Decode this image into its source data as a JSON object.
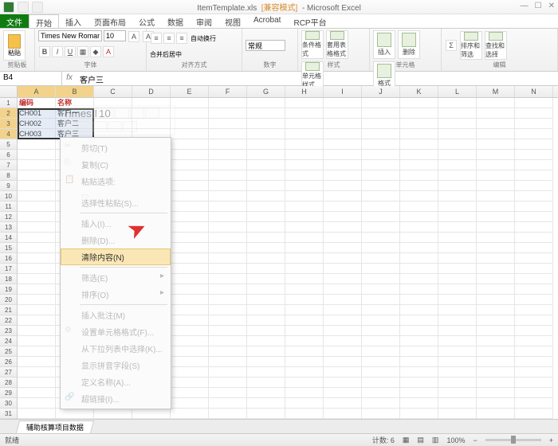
{
  "title": {
    "filename": "ItemTemplate.xls",
    "compat": "[兼容模式]",
    "app": "- Microsoft Excel"
  },
  "tabs": {
    "file": "文件",
    "home": "开始",
    "insert": "插入",
    "layout": "页面布局",
    "formulas": "公式",
    "data": "数据",
    "review": "审阅",
    "view": "视图",
    "acrobat": "Acrobat",
    "rcp": "RCP平台"
  },
  "ribbon": {
    "clipboard": {
      "label": "剪贴板",
      "paste": "粘贴"
    },
    "font": {
      "label": "字体",
      "name": "Times New Roman",
      "size": "10"
    },
    "align": {
      "label": "对齐方式",
      "wrap": "自动换行",
      "merge": "合并后居中"
    },
    "number": {
      "label": "数字",
      "general": "常规"
    },
    "styles": {
      "label": "样式",
      "cond": "条件格式",
      "table": "套用表格格式",
      "cell": "单元格样式"
    },
    "cells": {
      "label": "单元格",
      "insert": "插入",
      "delete": "删除",
      "format": "格式"
    },
    "editing": {
      "label": "编辑",
      "sort": "排序和筛选",
      "find": "查找和选择"
    }
  },
  "namebox": "B4",
  "formula": "客户三",
  "cols": [
    "A",
    "B",
    "C",
    "D",
    "E",
    "F",
    "G",
    "H",
    "I",
    "J",
    "K",
    "L",
    "M",
    "N"
  ],
  "headers": {
    "a": "编码",
    "b": "名称"
  },
  "data_rows": [
    {
      "a": "CH001",
      "b": "客户一"
    },
    {
      "a": "CH002",
      "b": "客户二"
    },
    {
      "a": "CH003",
      "b": "客户三"
    }
  ],
  "context": {
    "cut": "剪切(T)",
    "copy": "复制(C)",
    "pasteopt": "粘贴选项:",
    "pastespecial": "选择性粘贴(S)...",
    "insert": "插入(I)...",
    "delete": "删除(D)...",
    "clear": "清除内容(N)",
    "filter": "筛选(E)",
    "sort": "排序(O)",
    "comment": "插入批注(M)",
    "format": "设置单元格格式(F)...",
    "dropdown": "从下拉列表中选择(K)...",
    "pinyin": "显示拼音字段(S)",
    "name": "定义名称(A)...",
    "link": "超链接(I)..."
  },
  "minifont": "Times N",
  "minisize": "10",
  "sheet": "辅助核算项目数据",
  "status": {
    "ready": "就绪",
    "count": "计数: 6",
    "zoom": "100%"
  }
}
